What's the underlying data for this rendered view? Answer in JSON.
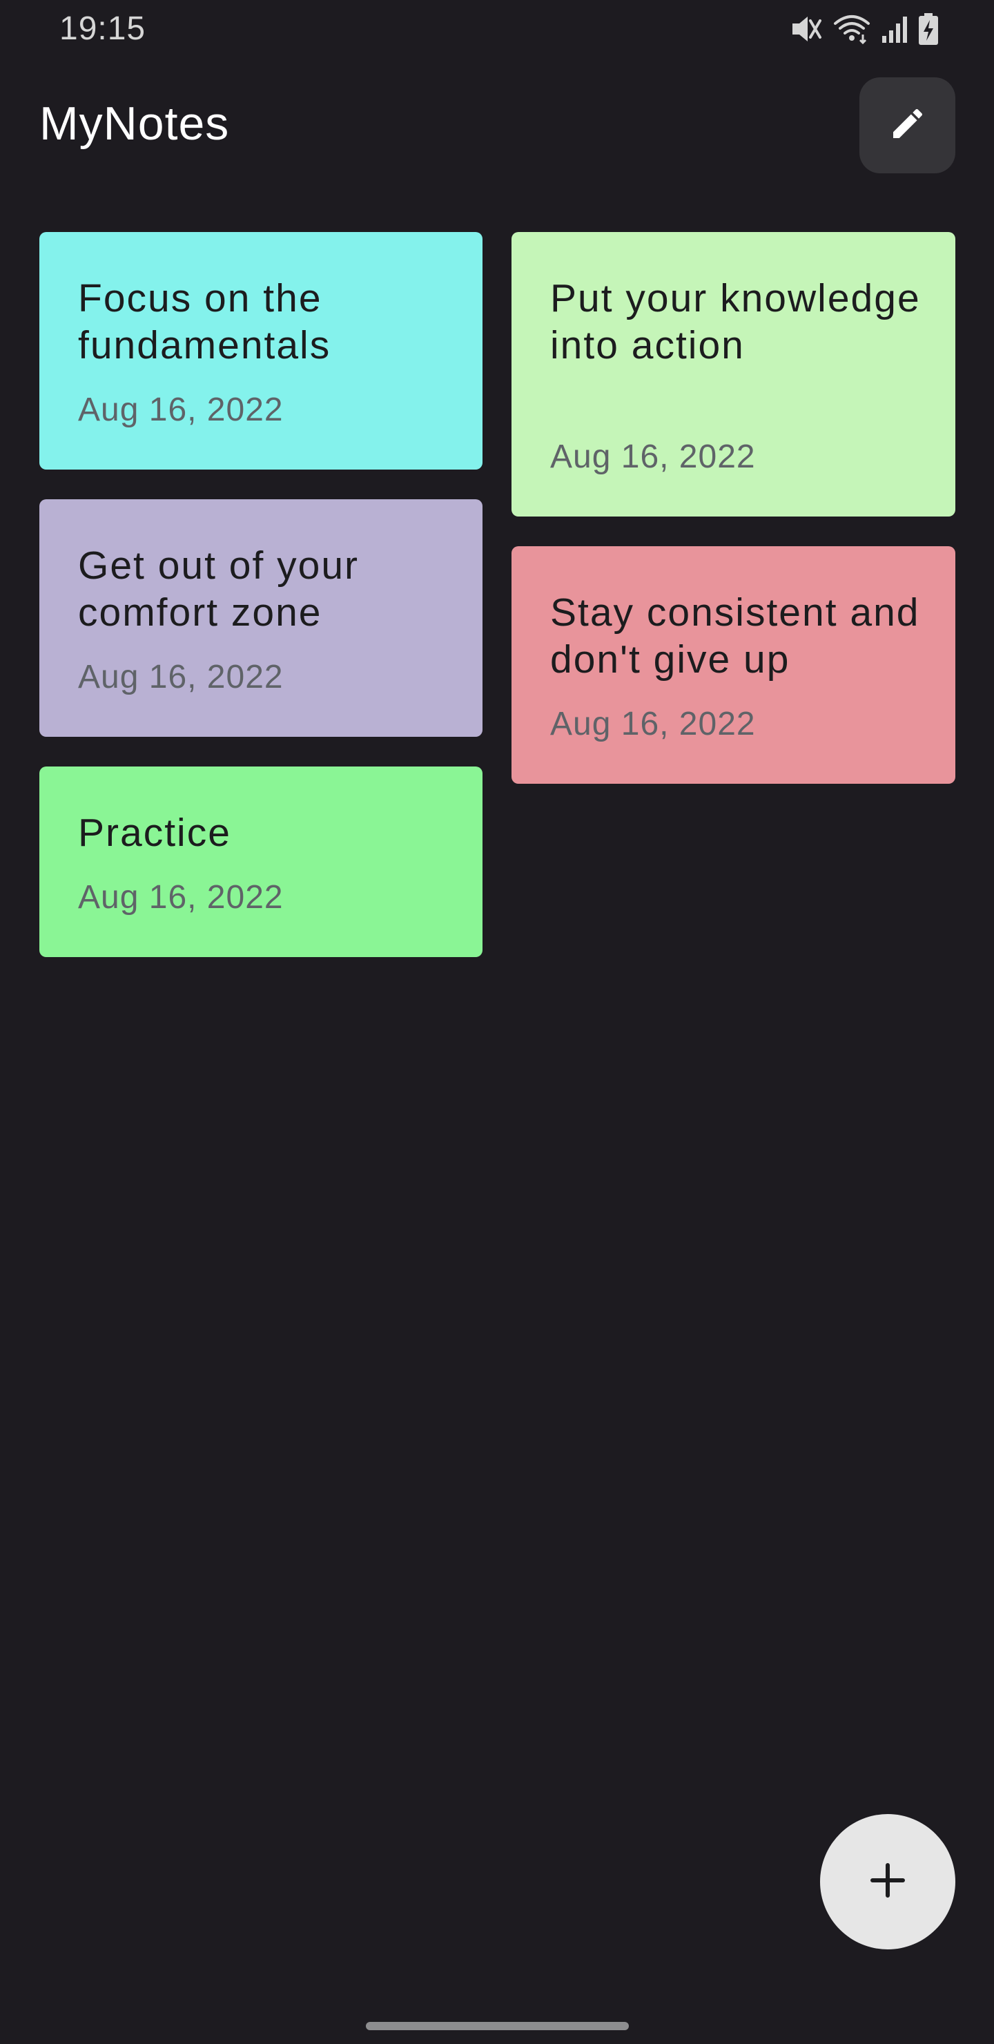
{
  "status_bar": {
    "time": "19:15",
    "icons": [
      "mute-icon",
      "wifi-icon",
      "signal-icon",
      "battery-charging-icon"
    ]
  },
  "header": {
    "title": "MyNotes",
    "edit_icon": "pencil-icon"
  },
  "notes": [
    {
      "title": "Focus on the fundamentals",
      "date": "Aug 16, 2022",
      "color": "#84f2ec"
    },
    {
      "title": "Put your knowledge into action",
      "date": "Aug 16, 2022",
      "color": "#c5f5b8"
    },
    {
      "title": "Get out of your comfort zone",
      "date": "Aug 16, 2022",
      "color": "#b9b1d3"
    },
    {
      "title": "Stay consistent and don't give up",
      "date": "Aug 16, 2022",
      "color": "#e8949b"
    },
    {
      "title": "Practice",
      "date": "Aug 16, 2022",
      "color": "#8af595"
    }
  ],
  "fab": {
    "icon": "plus-icon"
  },
  "colors": {
    "background": "#1d1b20",
    "edit_button": "#353438",
    "fab": "#e6e6e6"
  }
}
